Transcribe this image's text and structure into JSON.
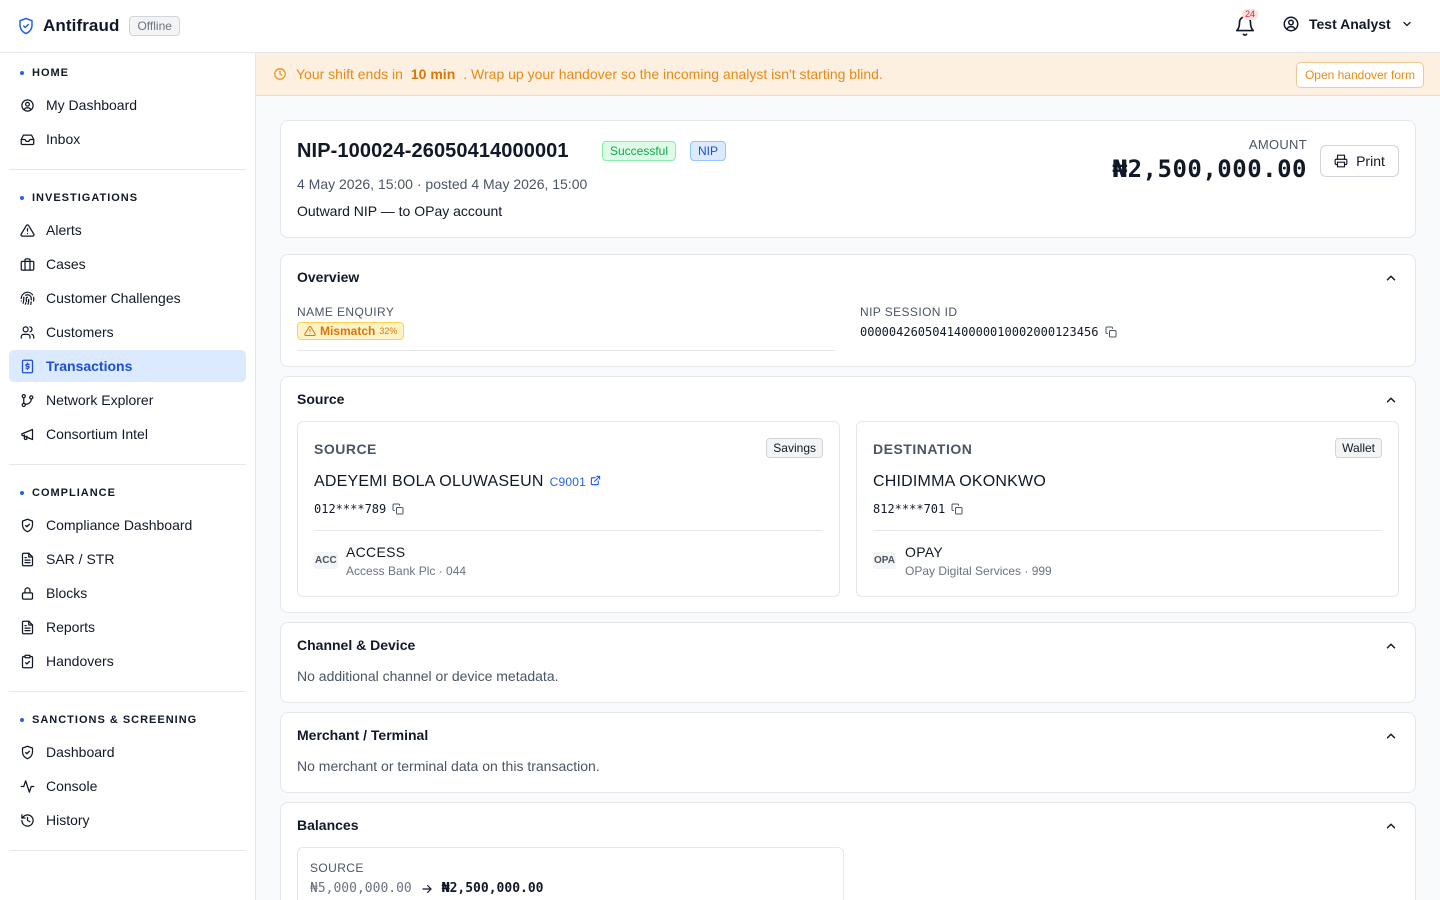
{
  "header": {
    "brand": "Antifraud",
    "status": "Offline",
    "notifications": "24",
    "user_name": "Test Analyst"
  },
  "sidebar": {
    "sections": [
      {
        "title": "HOME",
        "items": [
          "My Dashboard",
          "Inbox"
        ]
      },
      {
        "title": "INVESTIGATIONS",
        "items": [
          "Alerts",
          "Cases",
          "Customer Challenges",
          "Customers",
          "Transactions",
          "Network Explorer",
          "Consortium Intel"
        ]
      },
      {
        "title": "COMPLIANCE",
        "items": [
          "Compliance Dashboard",
          "SAR / STR",
          "Blocks",
          "Reports",
          "Handovers"
        ]
      },
      {
        "title": "SANCTIONS & SCREENING",
        "items": [
          "Dashboard",
          "Console",
          "History"
        ]
      }
    ],
    "active_item": "Transactions"
  },
  "banner": {
    "prefix": "Your shift ends in",
    "time": "10 min",
    "suffix": ". Wrap up your handover so the incoming analyst isn't starting blind.",
    "button": "Open handover form"
  },
  "transaction": {
    "id": "NIP-100024-26050414000001",
    "status": "Successful",
    "channel": "NIP",
    "dates": "4 May 2026, 15:00 · posted 4 May 2026, 15:00",
    "description": "Outward NIP — to OPay account",
    "amount_label": "AMOUNT",
    "amount": "₦2,500,000.00",
    "print_label": "Print"
  },
  "overview": {
    "title": "Overview",
    "name_enquiry_label": "NAME ENQUIRY",
    "name_enquiry_value": "Mismatch",
    "name_enquiry_score": "32%",
    "session_label": "NIP SESSION ID",
    "session_value": "000004260504140000010002000123456"
  },
  "source_section": {
    "title": "Source",
    "source": {
      "type": "SOURCE",
      "tag": "Savings",
      "name": "ADEYEMI BOLA OLUWASEUN",
      "customer_link": "C9001",
      "account": "012****789",
      "bank_abbr": "ACC",
      "bank": "ACCESS",
      "bank_sub": "Access Bank Plc · 044"
    },
    "destination": {
      "type": "DESTINATION",
      "tag": "Wallet",
      "name": "CHIDIMMA OKONKWO",
      "account": "812****701",
      "bank_abbr": "OPA",
      "bank": "OPAY",
      "bank_sub": "OPay Digital Services · 999"
    }
  },
  "channel_section": {
    "title": "Channel & Device",
    "text": "No additional channel or device metadata."
  },
  "merchant_section": {
    "title": "Merchant / Terminal",
    "text": "No merchant or terminal data on this transaction."
  },
  "balances_section": {
    "title": "Balances",
    "source_label": "SOURCE",
    "before": "₦5,000,000.00",
    "after": "₦2,500,000.00"
  },
  "colors": {
    "accent": "#2563eb",
    "banner_bg": "#fdf0e0",
    "warning": "#ea8a14"
  }
}
